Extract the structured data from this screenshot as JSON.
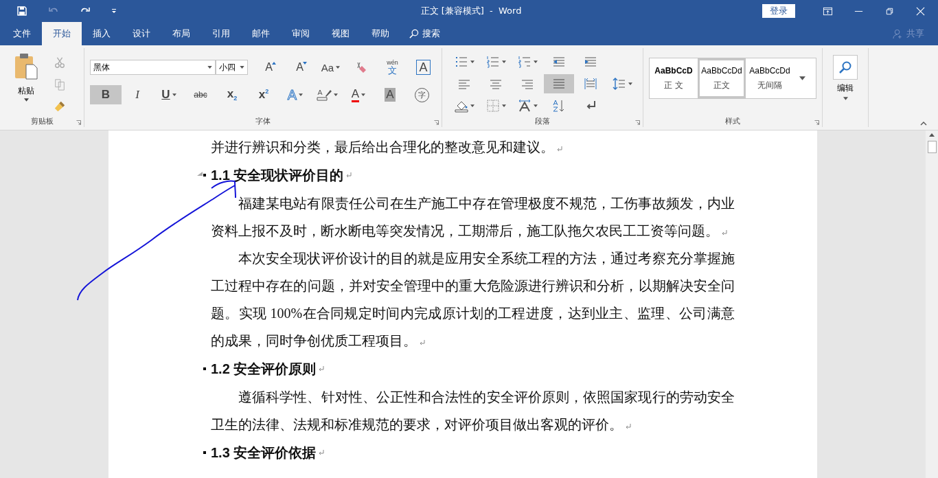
{
  "title_bar": {
    "title": "正文 [兼容模式]  -  Word",
    "login": "登录"
  },
  "tabs": [
    {
      "label": "文件",
      "selected": false
    },
    {
      "label": "开始",
      "selected": true
    },
    {
      "label": "插入",
      "selected": false
    },
    {
      "label": "设计",
      "selected": false
    },
    {
      "label": "布局",
      "selected": false
    },
    {
      "label": "引用",
      "selected": false
    },
    {
      "label": "邮件",
      "selected": false
    },
    {
      "label": "审阅",
      "selected": false
    },
    {
      "label": "视图",
      "selected": false
    },
    {
      "label": "帮助",
      "selected": false
    }
  ],
  "search": {
    "label": "搜索"
  },
  "share": {
    "label": "共享"
  },
  "clipboard": {
    "paste": "粘贴",
    "label": "剪贴板"
  },
  "font": {
    "label": "字体",
    "font_name": "黑体",
    "font_size": "小四",
    "row_1": [
      {
        "kind": "grow",
        "glyph": "A",
        "selected": false
      },
      {
        "kind": "shrink",
        "glyph": "A",
        "selected": false
      },
      {
        "kind": "case",
        "glyph": "Aa",
        "selected": false
      },
      {
        "kind": "clear",
        "selected": false
      },
      {
        "kind": "phonetic",
        "glyph": "wén",
        "sub": "文",
        "selected": false
      },
      {
        "kind": "border",
        "glyph": "A",
        "selected": false
      }
    ],
    "row_2": [
      {
        "kind": "bold",
        "glyph": "B",
        "selected": true
      },
      {
        "kind": "italic",
        "glyph": "I",
        "selected": false
      },
      {
        "kind": "underline",
        "glyph": "U",
        "selected": false
      },
      {
        "kind": "strike",
        "glyph": "abc",
        "selected": false
      },
      {
        "kind": "script",
        "glyph": "x$_{2}$",
        "selected": false
      },
      {
        "kind": "script",
        "glyph": "x$^{2}$",
        "selected": false
      },
      {
        "kind": "effects",
        "glyph": "A",
        "selected": false
      },
      {
        "kind": "highlight",
        "selected": false
      },
      {
        "kind": "color",
        "glyph": "A",
        "selected": false
      },
      {
        "kind": "shading",
        "glyph": "A",
        "selected": false
      },
      {
        "kind": "enclose",
        "glyph": "字",
        "selected": false
      }
    ]
  },
  "paragraph": {
    "label": "段落",
    "rows": [
      [
        {
          "kind": "bullets",
          "selected": false
        },
        {
          "kind": "numbering",
          "selected": false
        },
        {
          "kind": "multilevel",
          "selected": false
        },
        {
          "kind": "outdent",
          "selected": false
        },
        {
          "kind": "indent",
          "selected": false
        }
      ],
      [
        {
          "kind": "left",
          "selected": false
        },
        {
          "kind": "center",
          "selected": false
        },
        {
          "kind": "right",
          "selected": false
        },
        {
          "kind": "justify",
          "selected": true
        },
        {
          "kind": "distribute",
          "selected": false
        },
        {
          "kind": "spacing",
          "selected": false
        }
      ],
      [
        {
          "kind": "fill",
          "selected": false
        },
        {
          "kind": "borders",
          "selected": false
        },
        {
          "kind": "asian",
          "selected": false
        },
        {
          "kind": "sort",
          "selected": false
        },
        {
          "kind": "marks",
          "selected": false
        }
      ]
    ]
  },
  "styles": {
    "label": "样式",
    "items": [
      {
        "preview": "AaBbCcD",
        "name": "正 文",
        "bold": true,
        "selected": false
      },
      {
        "preview": "AaBbCcDd",
        "name": "正文",
        "bold": false,
        "selected": true
      },
      {
        "preview": "AaBbCcDd",
        "name": "无间隔",
        "bold": false,
        "selected": false
      }
    ]
  },
  "editing": {
    "label": "编辑"
  },
  "document": [
    {
      "kind": "body",
      "indent": false,
      "text": "并进行辨识和分类，最后给出合理化的整改意见和建议。"
    },
    {
      "kind": "heading",
      "handle": true,
      "text": "1.1 安全现状评价目的"
    },
    {
      "kind": "body",
      "indent": true,
      "text": "福建某电站有限责任公司在生产施工中存在管理极度不规范，工伤事故频发，内业资料上报不及时，断水断电等突发情况，工期滞后，施工队拖欠农民工工资等问题。"
    },
    {
      "kind": "body",
      "indent": true,
      "text": "本次安全现状评价设计的目的就是应用安全系统工程的方法，通过考察充分掌握施工过程中存在的问题，并对安全管理中的重大危险源进行辨识和分析，以期解决安全问题。实现 100%在合同规定时间内完成原计划的工程进度，达到业主、监理、公司满意的成果，同时争创优质工程项目。"
    },
    {
      "kind": "heading",
      "handle": false,
      "text": "1.2 安全评价原则"
    },
    {
      "kind": "body",
      "indent": true,
      "text": "遵循科学性、针对性、公正性和合法性的安全评价原则，依照国家现行的劳动安全卫生的法律、法规和标准规范的要求，对评价项目做出客观的评价。"
    },
    {
      "kind": "heading",
      "handle": false,
      "text": "1.3 安全评价依据"
    }
  ]
}
